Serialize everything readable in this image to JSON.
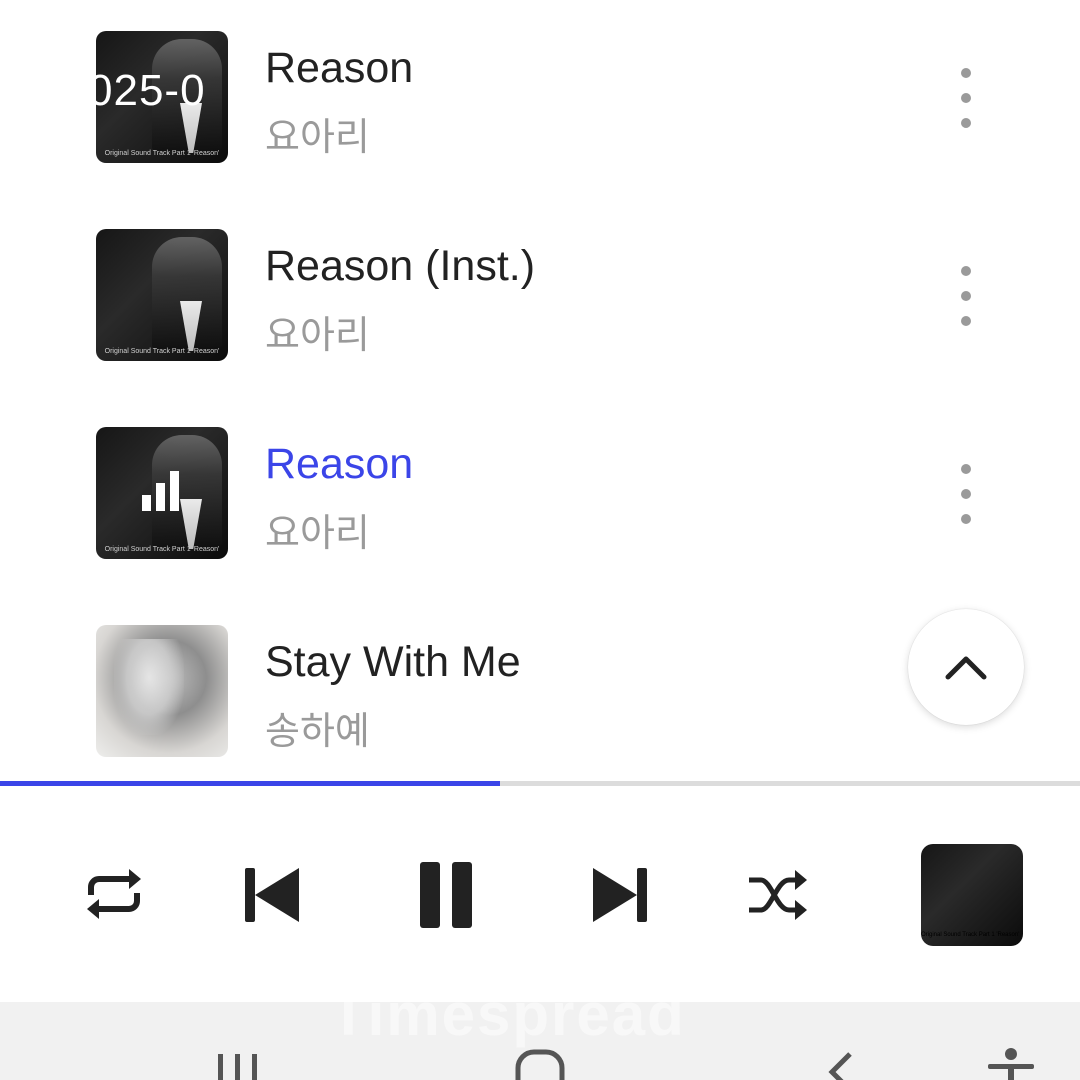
{
  "tracks": [
    {
      "title": "Reason",
      "artist": "요아리",
      "active": false,
      "cover": "dark"
    },
    {
      "title": "Reason (Inst.)",
      "artist": "요아리",
      "active": false,
      "cover": "dark"
    },
    {
      "title": "Reason",
      "artist": "요아리",
      "active": true,
      "cover": "dark"
    },
    {
      "title": "Stay With Me",
      "artist": "송하예",
      "active": false,
      "cover": "light"
    }
  ],
  "cover_overlay_text": "025-0",
  "cover_caption": "Original Sound Track Part 1  'Reason'",
  "progress": {
    "fraction": 0.463,
    "color": "#3b45e8"
  },
  "colors": {
    "accent": "#3b45e8",
    "title": "#222222",
    "subtitle": "#9a9a9a"
  },
  "controls": {
    "icons": [
      "repeat-icon",
      "previous-icon",
      "pause-icon",
      "next-icon",
      "shuffle-icon"
    ]
  },
  "navbar": {
    "watermark": "Timespread",
    "icons": [
      "recent-apps-icon",
      "home-icon",
      "back-icon",
      "accessibility-icon"
    ]
  }
}
